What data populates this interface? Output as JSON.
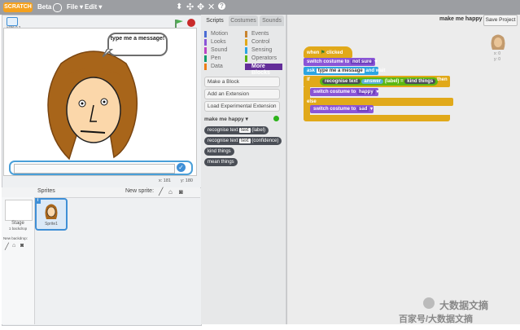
{
  "topbar": {
    "logo": "SCRATCH",
    "beta": "Beta",
    "file_menu": "File",
    "edit_menu": "Edit",
    "colors": {
      "bar": "#9c9ea2",
      "logo": "#f4a11e"
    }
  },
  "stage": {
    "version": "v456.0.2",
    "speech": "type me a message!",
    "coord_x": "x: 181",
    "coord_y": "y: 180"
  },
  "sprites_panel": {
    "title": "Sprites",
    "new_sprite": "New sprite:",
    "stage_label": "Stage",
    "stage_backdrops": "1 backdrop",
    "new_backdrop": "New backdrop:",
    "sprite_name": "Sprite1",
    "sprite_badge": "i"
  },
  "palette": {
    "tabs": [
      "Scripts",
      "Costumes",
      "Sounds"
    ],
    "categories_left": [
      {
        "label": "Motion",
        "color": "#4a6cd4"
      },
      {
        "label": "Looks",
        "color": "#8a55d7"
      },
      {
        "label": "Sound",
        "color": "#bb42c3"
      },
      {
        "label": "Pen",
        "color": "#0e9a6c"
      },
      {
        "label": "Data",
        "color": "#ee7d16"
      }
    ],
    "categories_right": [
      {
        "label": "Events",
        "color": "#c88330"
      },
      {
        "label": "Control",
        "color": "#e1a91a"
      },
      {
        "label": "Sensing",
        "color": "#2ca5e2"
      },
      {
        "label": "Operators",
        "color": "#5cb712"
      },
      {
        "label": "More Blocks",
        "color": "#632d99"
      }
    ],
    "make_block": "Make a Block",
    "add_extension": "Add an Extension",
    "load_extension": "Load Experimental Extension",
    "extension_name": "make me happy",
    "reporters": [
      {
        "label": "recognise text",
        "slot": "text",
        "suffix": "(label)"
      },
      {
        "label": "recognise text",
        "slot": "text",
        "suffix": "(confidence)"
      },
      {
        "label": "kind things",
        "slot": "",
        "suffix": ""
      },
      {
        "label": "mean things",
        "slot": "",
        "suffix": ""
      }
    ]
  },
  "scripts": {
    "project_title": "make me happy",
    "save_button": "Save Project",
    "sprite_x": "x: 0",
    "sprite_y": "y: 0",
    "blocks": {
      "when": "when",
      "clicked": "clicked",
      "switch_costume": "switch costume to",
      "costume_initial": "not sure",
      "ask": "ask",
      "ask_text": "type me a message",
      "and_wait": "and wait",
      "if": "if",
      "recognise_text": "recognise text",
      "answer": "answer",
      "label": "(label)",
      "equals": "=",
      "kind_things": "kind things",
      "then": "then",
      "costume_happy": "happy",
      "else": "else",
      "costume_sad": "sad"
    }
  },
  "watermark": {
    "line1": "大数据文摘",
    "line2": "百家号/大数据文摘"
  }
}
